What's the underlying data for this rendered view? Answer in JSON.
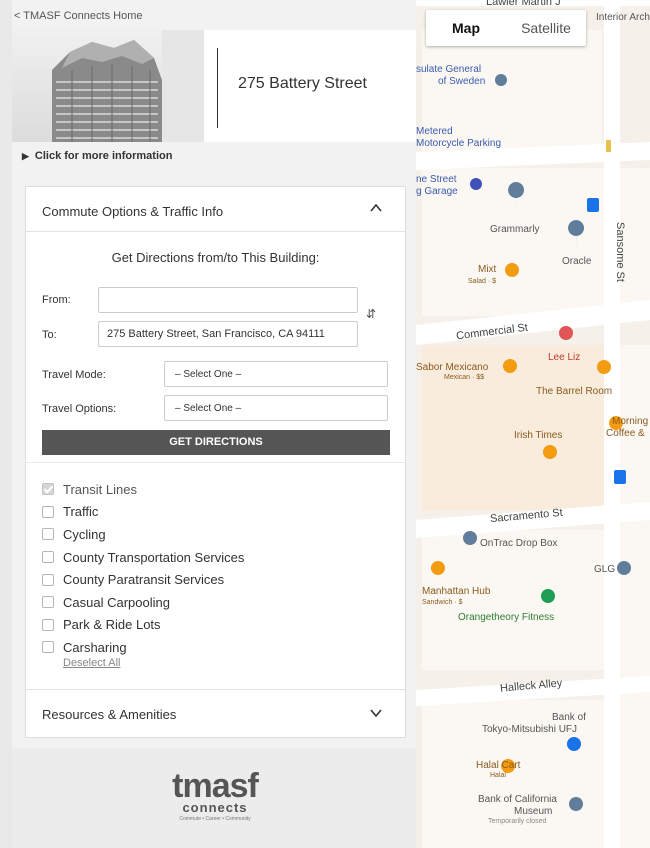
{
  "panel": {
    "back_link": "< TMASF Connects Home",
    "building_name": "275 Battery Street",
    "more_info": "Click for more information"
  },
  "commute": {
    "section_title": "Commute Options & Traffic Info",
    "directions_title": "Get Directions from/to This Building:",
    "from_label": "From:",
    "from_value": "",
    "to_label": "To:",
    "to_value": "275 Battery Street, San Francisco, CA 94111",
    "travel_mode_label": "Travel Mode:",
    "travel_mode_value": "– Select One –",
    "travel_options_label": "Travel Options:",
    "travel_options_value": "– Select One –",
    "get_directions_label": "GET DIRECTIONS",
    "layers": [
      {
        "label": "Transit Lines",
        "checked": true
      },
      {
        "label": "Traffic",
        "checked": false
      },
      {
        "label": "Cycling",
        "checked": false
      },
      {
        "label": "County Transportation Services",
        "checked": false
      },
      {
        "label": "County Paratransit Services",
        "checked": false
      },
      {
        "label": "Casual Carpooling",
        "checked": false
      },
      {
        "label": "Park & Ride Lots",
        "checked": false
      },
      {
        "label": "Carsharing",
        "checked": false
      }
    ],
    "deselect_all": "Deselect All"
  },
  "resources": {
    "section_title": "Resources & Amenities"
  },
  "logo": {
    "main": "tmasf",
    "sub": "connects",
    "tagline": "Commute • Career • Community"
  },
  "map": {
    "map_button": "Map",
    "satellite_button": "Satellite",
    "streets": {
      "lawler": "Lawler Martin J",
      "commercial": "Commercial St",
      "sacramento": "Sacramento St",
      "halleck": "Halleck Alley",
      "sansome": "Sansome St"
    },
    "pois": {
      "interior": "Interior Archite",
      "consulate_1": "sulate General",
      "consulate_2": "of Sweden",
      "metered_1": "Metered",
      "metered_2": "Motorcycle Parking",
      "garage_1": "ne Street",
      "garage_2": "g Garage",
      "grammarly": "Grammarly",
      "oracle": "Oracle",
      "mixt": "Mixt",
      "mixt_sub": "Salad · $",
      "sabor": "Sabor Mexicano",
      "sabor_sub": "Mexican · $$",
      "leeliz": "Lee Liz",
      "barrel": "The Barrel Room",
      "morning_1": "Morning",
      "morning_2": "Coffee &",
      "irish": "Irish Times",
      "ontrac": "OnTrac Drop Box",
      "glg": "GLG",
      "manhattan": "Manhattan Hub",
      "manhattan_sub": "Sandwich · $",
      "orangetheory": "Orangetheory Fitness",
      "bank_tokyo_1": "Bank of",
      "bank_tokyo_2": "Tokyo-Mitsubishi UFJ",
      "halal": "Halal Cart",
      "halal_sub": "Halal",
      "boc_1": "Bank of California",
      "boc_2": "Museum",
      "boc_3": "Temporarily closed"
    }
  },
  "colors": {
    "button_dark": "#555555",
    "map_bg": "#f5f1ea",
    "poi_orange": "#f39c12",
    "poi_blue": "#1a73e8",
    "poi_gray_blue": "#607d9b",
    "poi_green": "#1e9e55",
    "poi_red": "#e05555"
  }
}
